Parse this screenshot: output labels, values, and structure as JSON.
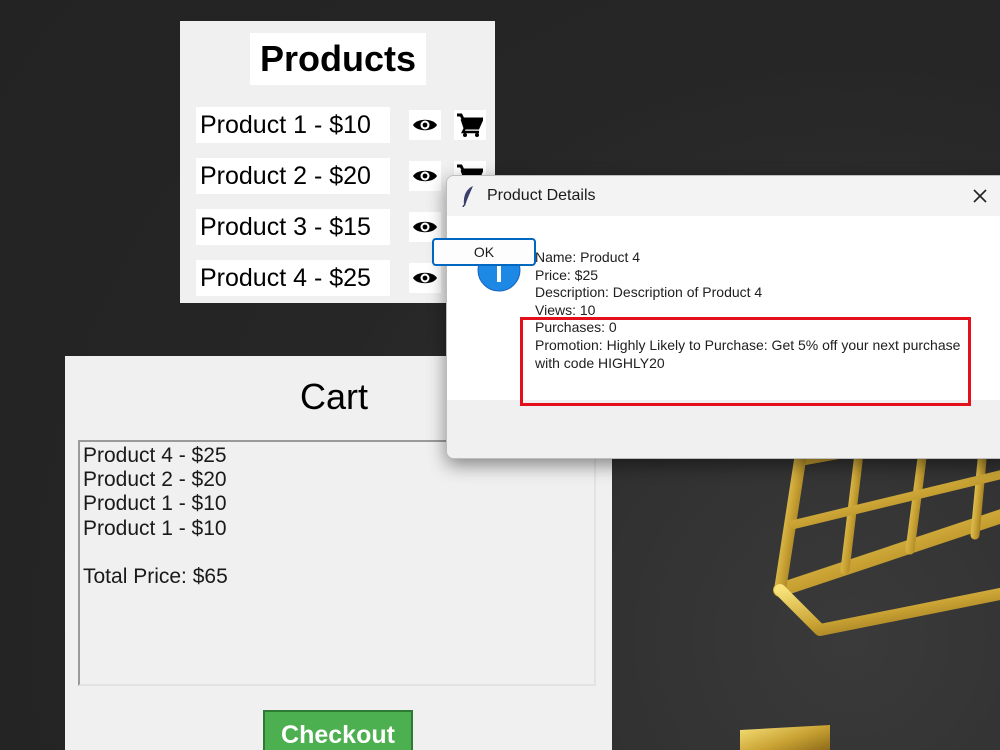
{
  "products": {
    "title": "Products",
    "items": [
      {
        "label": "Product 1 - $10"
      },
      {
        "label": "Product 2 - $20"
      },
      {
        "label": "Product 3 - $15"
      },
      {
        "label": "Product 4 - $25"
      }
    ]
  },
  "cart": {
    "title": "Cart",
    "items": [
      "Product 4 - $25",
      "Product 2 - $20",
      "Product 1 - $10",
      "Product 1 - $10"
    ],
    "total": "Total Price: $65",
    "checkout_label": "Checkout"
  },
  "dialog": {
    "title": "Product Details",
    "lines": {
      "name": "Name: Product 4",
      "price": "Price: $25",
      "description": "Description: Description of Product 4",
      "views": "Views: 10",
      "purchases": "Purchases: 0",
      "promotion": "Promotion: Highly Likely to Purchase: Get 5% off your next purchase with code HIGHLY20"
    },
    "ok_label": "OK"
  },
  "colors": {
    "checkout_green": "#4caf50",
    "highlight_red": "#e3101b",
    "info_blue": "#1e88e5",
    "ok_border": "#0067c0"
  },
  "icons": [
    "eye-icon",
    "cart-icon",
    "feather-icon",
    "close-icon",
    "info-icon"
  ]
}
